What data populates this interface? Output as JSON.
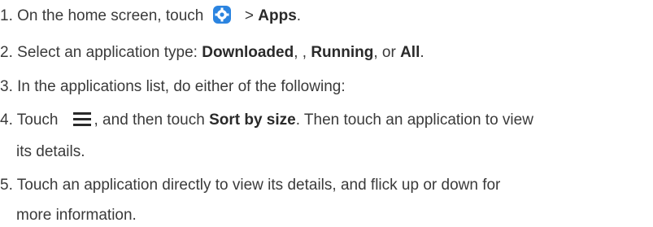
{
  "steps": [
    {
      "num": "1.",
      "text_a": "On the home screen, touch",
      "icon": "settings-icon",
      "text_b": "> ",
      "bold_b": "Apps",
      "text_c": "."
    },
    {
      "num": "2.",
      "text_a": "Select an application type: ",
      "bold_a": "Downloaded",
      "text_b": ", , ",
      "bold_b": "Running",
      "text_c": ", or ",
      "bold_c": "All",
      "text_d": "."
    },
    {
      "num": "3.",
      "text_a": "In the applications list, do either of the following:"
    },
    {
      "num": "4.",
      "text_a": "Touch",
      "icon": "menu-icon",
      "text_b": ", and then touch ",
      "bold_b": "Sort by size",
      "text_c": ". Then touch an application to view",
      "cont": "its details."
    },
    {
      "num": "5.",
      "text_a": "Touch an application directly to view its details, and flick up or down for",
      "cont": "more information."
    }
  ],
  "colors": {
    "icon_blue": "#2b84e0",
    "text": "#3a3a3a"
  }
}
